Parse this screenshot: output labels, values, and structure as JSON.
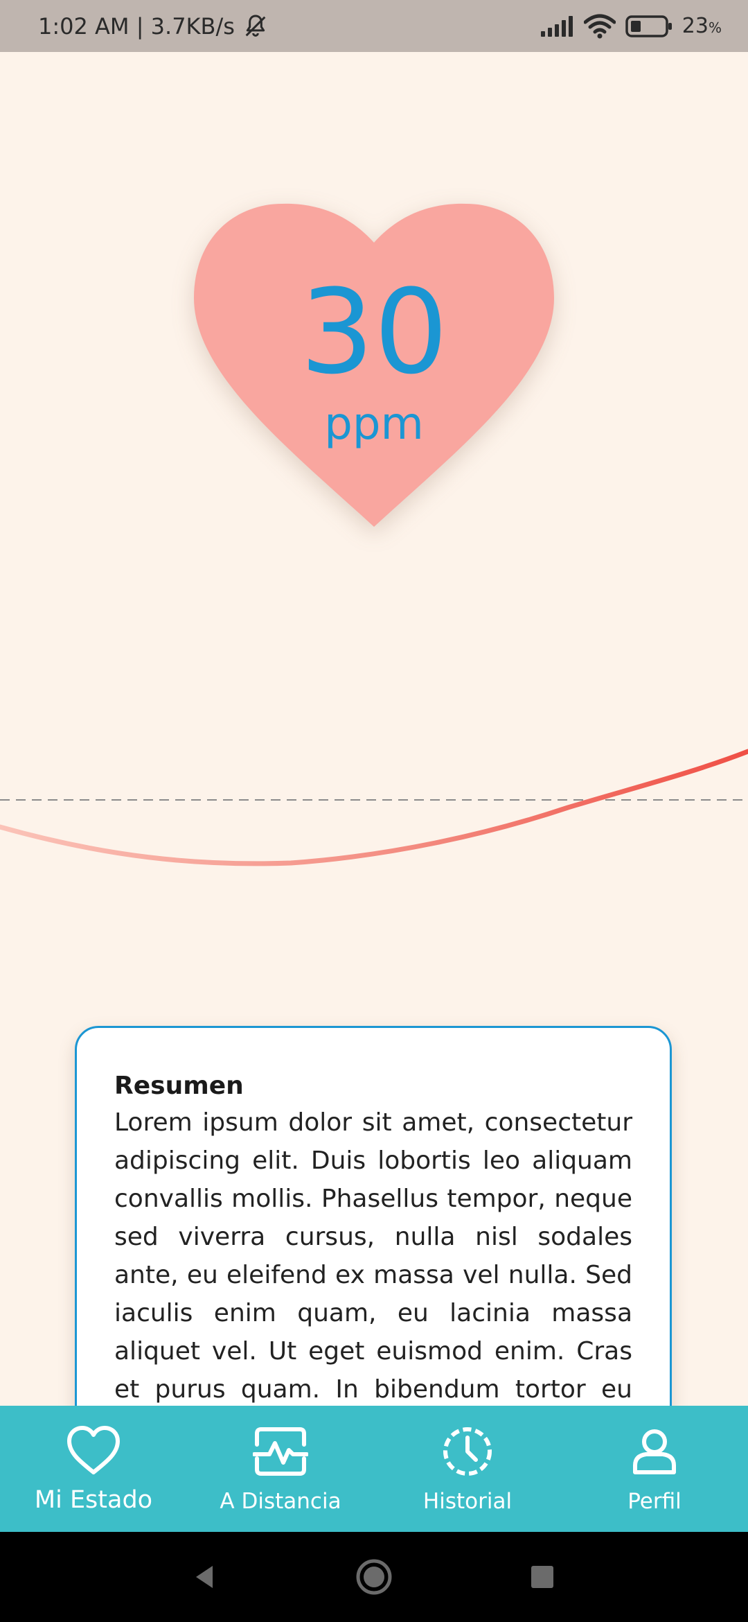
{
  "status_bar": {
    "time_speed": "1:02 AM | 3.7KB/s",
    "battery_level": "23",
    "battery_unit": "%",
    "icons": [
      "bell-off-icon",
      "signal-icon",
      "wifi-icon",
      "battery-icon"
    ]
  },
  "heart_rate": {
    "value": "30",
    "unit": "ppm",
    "heart_color": "#F9A69F",
    "text_color": "#1B96D3"
  },
  "summary": {
    "title": "Resumen",
    "body": "Lorem ipsum dolor sit amet, consectetur adipiscing elit. Duis lobortis leo aliquam convallis mollis. Phasellus tempor, neque sed viverra cursus, nulla nisl sodales ante, eu eleifend ex massa vel nulla. Sed iaculis enim quam, eu lacinia massa aliquet vel. Ut eget euismod enim. Cras et purus quam. In bibendum tortor eu risus"
  },
  "bottom_nav": {
    "background": "#3DBEC8",
    "items": [
      {
        "label": "Mi Estado",
        "icon": "heart-icon",
        "active": true
      },
      {
        "label": "A Distancia",
        "icon": "monitor-pulse-icon",
        "active": false
      },
      {
        "label": "Historial",
        "icon": "history-clock-icon",
        "active": false
      },
      {
        "label": "Perfil",
        "icon": "user-icon",
        "active": false
      }
    ]
  },
  "system_nav": {
    "buttons": [
      "back-icon",
      "home-icon",
      "recents-icon"
    ]
  },
  "colors": {
    "background": "#FDF3EA",
    "wave_start": "#FBC3B8",
    "wave_end": "#EF4F45",
    "card_border": "#1B96D3"
  }
}
